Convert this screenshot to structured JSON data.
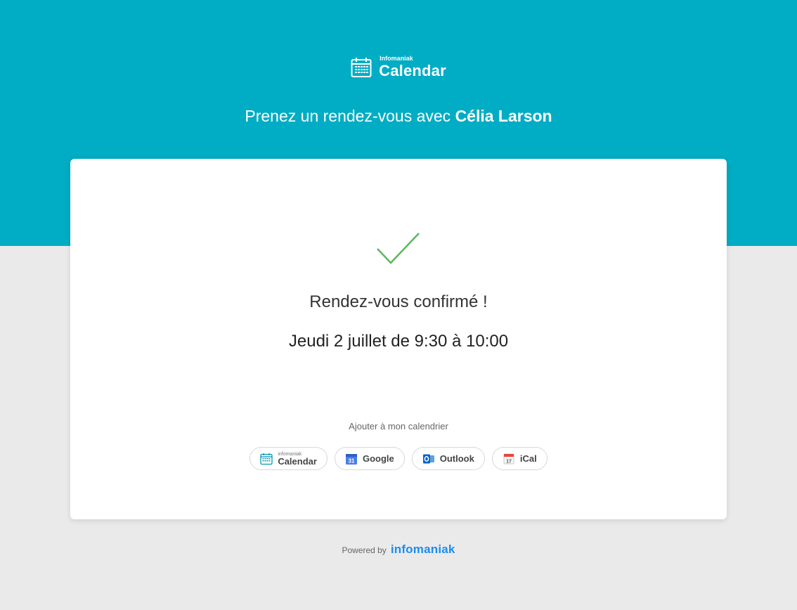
{
  "header": {
    "brand_small": "Infomaniak",
    "brand_big": "Calendar",
    "title_prefix": "Prenez un rendez-vous avec ",
    "title_name": "Célia Larson"
  },
  "confirmation": {
    "title": "Rendez-vous confirmé !",
    "datetime": "Jeudi 2 juillet de 9:30 à 10:00"
  },
  "add_calendar": {
    "label": "Ajouter à mon calendrier",
    "buttons": [
      {
        "icon": "infomaniak-calendar-icon",
        "small": "infomaniak",
        "label": "Calendar"
      },
      {
        "icon": "google-calendar-icon",
        "label": "Google"
      },
      {
        "icon": "outlook-icon",
        "label": "Outlook"
      },
      {
        "icon": "ical-icon",
        "label": "iCal"
      }
    ]
  },
  "footer": {
    "powered_label": "Powered by",
    "brand": "infomaniak"
  },
  "colors": {
    "hero": "#00adc4",
    "background": "#ebeaeb",
    "check": "#5cb85c",
    "brand_blue": "#1a8df0"
  }
}
